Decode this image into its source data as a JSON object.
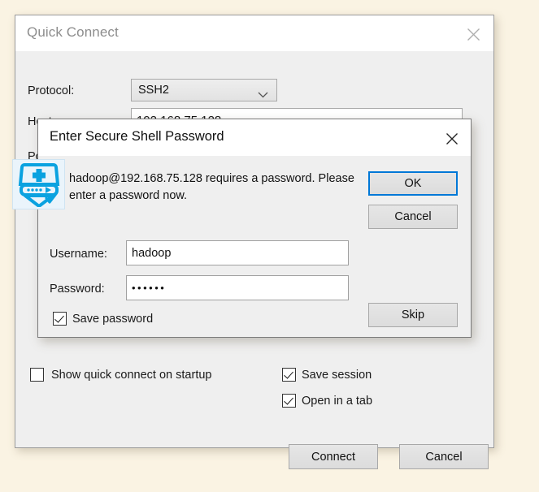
{
  "window": {
    "title": "Quick Connect",
    "close_icon": "close-icon",
    "protocol": {
      "label": "Protocol:",
      "value": "SSH2",
      "chevron_icon": "chevron-down-icon"
    },
    "hostname": {
      "label": "Hostname:",
      "value": "192.168.75.128",
      "placeholder": ""
    },
    "port": {
      "label": "Port:"
    },
    "options": {
      "show_quick_connect": {
        "label": "Show quick connect on startup",
        "checked": false
      },
      "save_session": {
        "label": "Save session",
        "checked": true
      },
      "open_in_tab": {
        "label": "Open in a tab",
        "checked": true
      }
    },
    "buttons": {
      "connect": "Connect",
      "cancel": "Cancel"
    }
  },
  "dialog": {
    "title": "Enter Secure Shell Password",
    "close_icon": "close-icon",
    "icon": "secure-shell-app-icon",
    "message": "hadoop@192.168.75.128 requires a password. Please enter a password now.",
    "username": {
      "label": "Username:",
      "value": "hadoop",
      "placeholder": ""
    },
    "password": {
      "label": "Password:",
      "value": "••••••",
      "placeholder": ""
    },
    "save_password": {
      "label": "Save password",
      "checked": true
    },
    "buttons": {
      "ok": "OK",
      "cancel": "Cancel",
      "skip": "Skip"
    }
  },
  "colors": {
    "accent": "#0078d7",
    "window_bg": "#efefef",
    "titlebar_bg": "#ffffff",
    "desktop_bg": "#faf3e3",
    "icon_blue": "#0aa2e0"
  }
}
